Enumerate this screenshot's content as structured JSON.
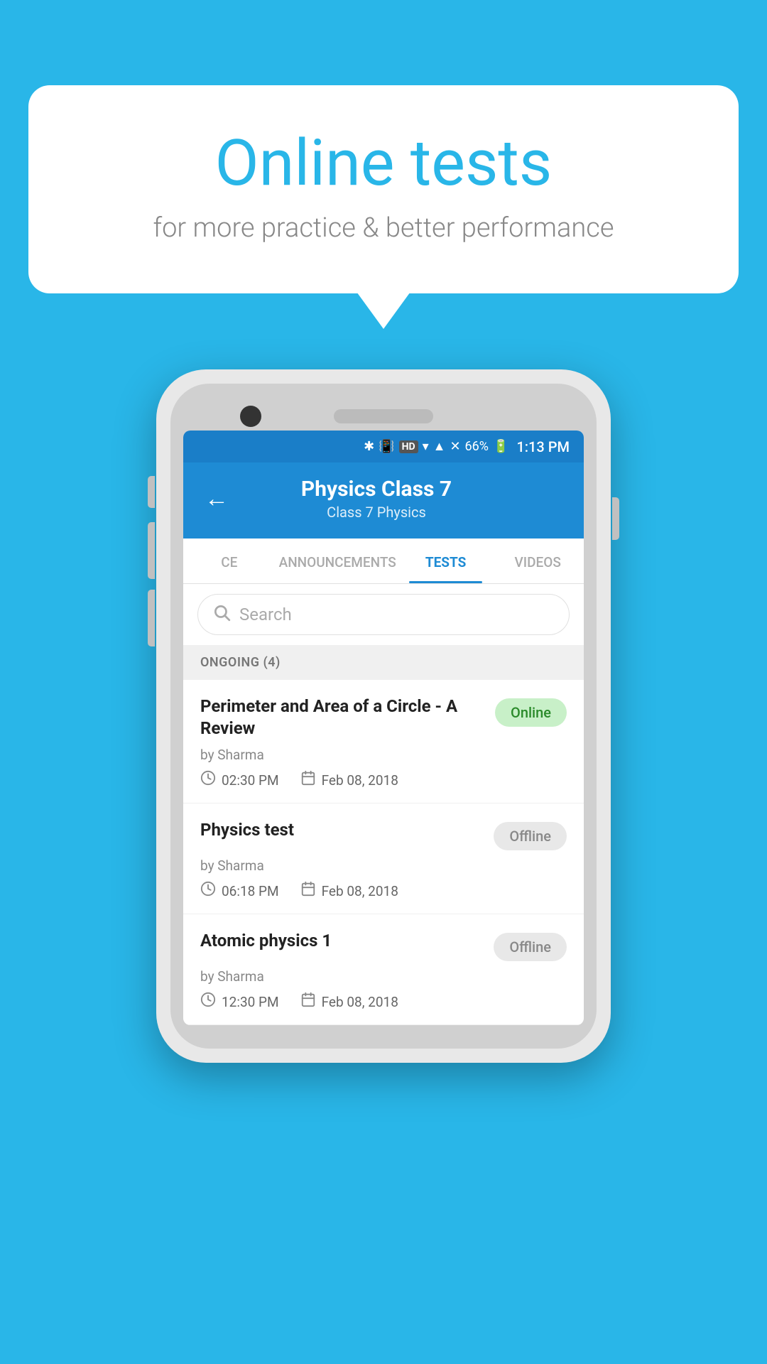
{
  "bubble": {
    "title": "Online tests",
    "subtitle": "for more practice & better performance"
  },
  "status_bar": {
    "battery_percent": "66%",
    "time": "1:13 PM"
  },
  "header": {
    "back_label": "←",
    "title": "Physics Class 7",
    "subtitle": "Class 7    Physics"
  },
  "tabs": [
    {
      "id": "ce",
      "label": "CE",
      "active": false
    },
    {
      "id": "announcements",
      "label": "ANNOUNCEMENTS",
      "active": false
    },
    {
      "id": "tests",
      "label": "TESTS",
      "active": true
    },
    {
      "id": "videos",
      "label": "VIDEOS",
      "active": false
    }
  ],
  "search": {
    "placeholder": "Search"
  },
  "section": {
    "label": "ONGOING (4)"
  },
  "tests": [
    {
      "title": "Perimeter and Area of a Circle - A Review",
      "author": "by Sharma",
      "time": "02:30 PM",
      "date": "Feb 08, 2018",
      "badge": "Online",
      "badge_type": "online"
    },
    {
      "title": "Physics test",
      "author": "by Sharma",
      "time": "06:18 PM",
      "date": "Feb 08, 2018",
      "badge": "Offline",
      "badge_type": "offline"
    },
    {
      "title": "Atomic physics 1",
      "author": "by Sharma",
      "time": "12:30 PM",
      "date": "Feb 08, 2018",
      "badge": "Offline",
      "badge_type": "offline"
    }
  ]
}
